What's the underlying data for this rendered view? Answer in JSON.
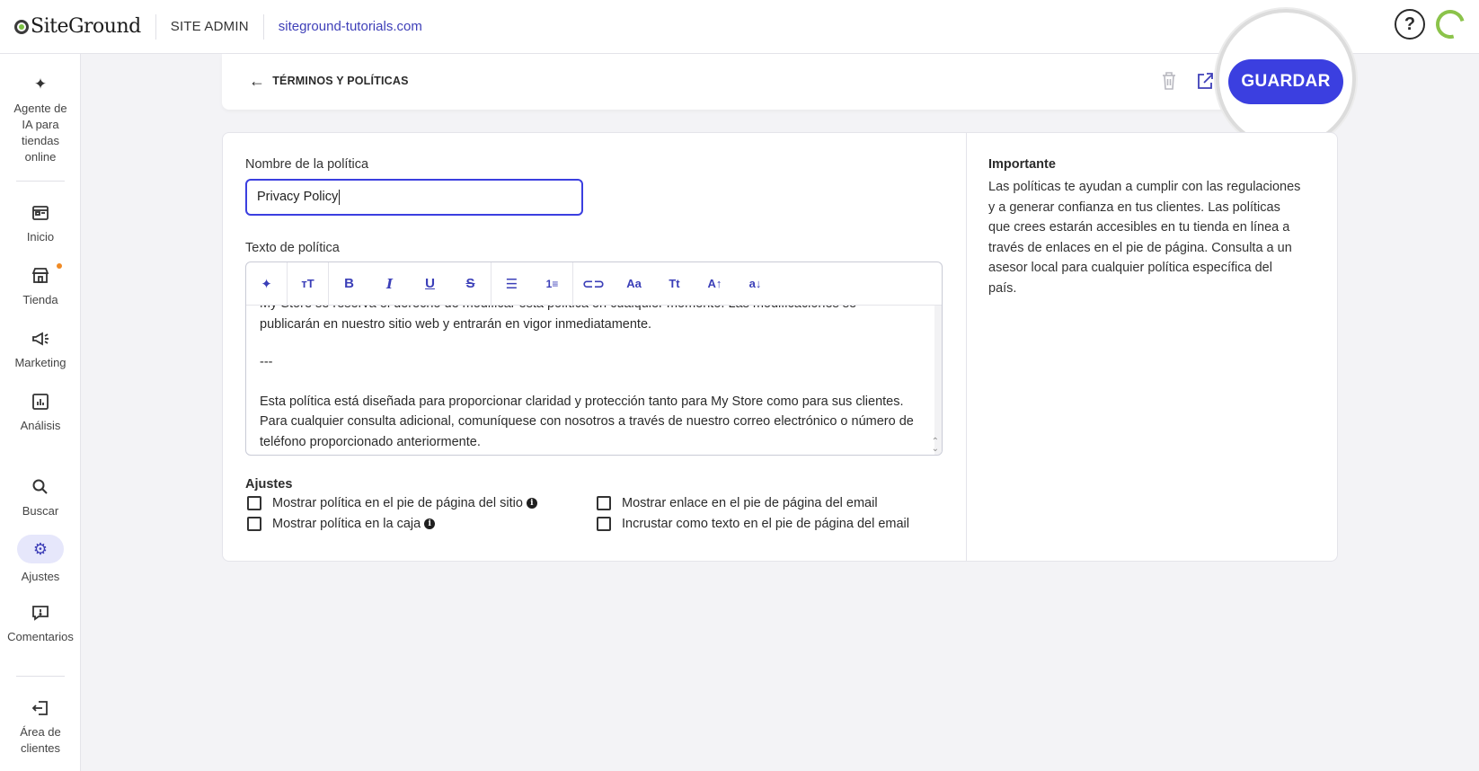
{
  "topbar": {
    "logo_text": "SiteGround",
    "admin_label": "SITE ADMIN",
    "site_domain": "siteground-tutorials.com",
    "help_label": "?"
  },
  "sidebar": {
    "items": [
      {
        "label": "Agente de IA para tiendas online",
        "icon": "sparkle-icon"
      },
      {
        "label": "Inicio",
        "icon": "home-icon"
      },
      {
        "label": "Tienda",
        "icon": "store-icon"
      },
      {
        "label": "Marketing",
        "icon": "megaphone-icon"
      },
      {
        "label": "Análisis",
        "icon": "analytics-icon"
      },
      {
        "label": "Buscar",
        "icon": "search-icon"
      },
      {
        "label": "Ajustes",
        "icon": "gear-icon"
      },
      {
        "label": "Comentarios",
        "icon": "feedback-icon"
      },
      {
        "label": "Área de clientes",
        "icon": "exit-icon"
      }
    ],
    "active": "Ajustes",
    "accent": "#3e3fb8",
    "notification_color": "#f08a24"
  },
  "header": {
    "back_label": "TÉRMINOS Y POLÍTICAS",
    "save_label": "GUARDAR",
    "save_color": "#3b3fe0"
  },
  "form": {
    "name_label": "Nombre de la política",
    "name_value": "Privacy Policy",
    "text_label": "Texto de política",
    "toolbar": [
      "ai-sparkle",
      "text-size",
      "bold",
      "italic",
      "underline",
      "strikethrough",
      "bullet-list",
      "numbered-list",
      "link",
      "font-case",
      "title-case",
      "uppercase",
      "lowercase"
    ],
    "editor_lines": {
      "cut_line": "My Store se reserva el derecho de modificar esta política en cualquier momento. Las modificaciones se",
      "p1": "publicarán en nuestro sitio web y entrarán en vigor inmediatamente.",
      "separator": "---",
      "p2": "Esta política está diseñada para proporcionar claridad y protección tanto para My Store como para sus clientes. Para cualquier consulta adicional, comuníquese con nosotros a través de nuestro correo electrónico o número de teléfono proporcionado anteriormente."
    },
    "settings_title": "Ajustes",
    "settings": {
      "footer_site": "Mostrar política en el pie de página del sitio",
      "checkout": "Mostrar política en la caja",
      "footer_email_link": "Mostrar enlace en el pie de página del email",
      "footer_email_text": "Incrustar como texto en el pie de página del email"
    }
  },
  "aside": {
    "title": "Importante",
    "body": "Las políticas te ayudan a cumplir con las regulaciones y a generar confianza en tus clientes. Las políticas que crees estarán accesibles en tu tienda en línea a través de enlaces en el pie de página. Consulta a un asesor local para cualquier política específica del país."
  }
}
